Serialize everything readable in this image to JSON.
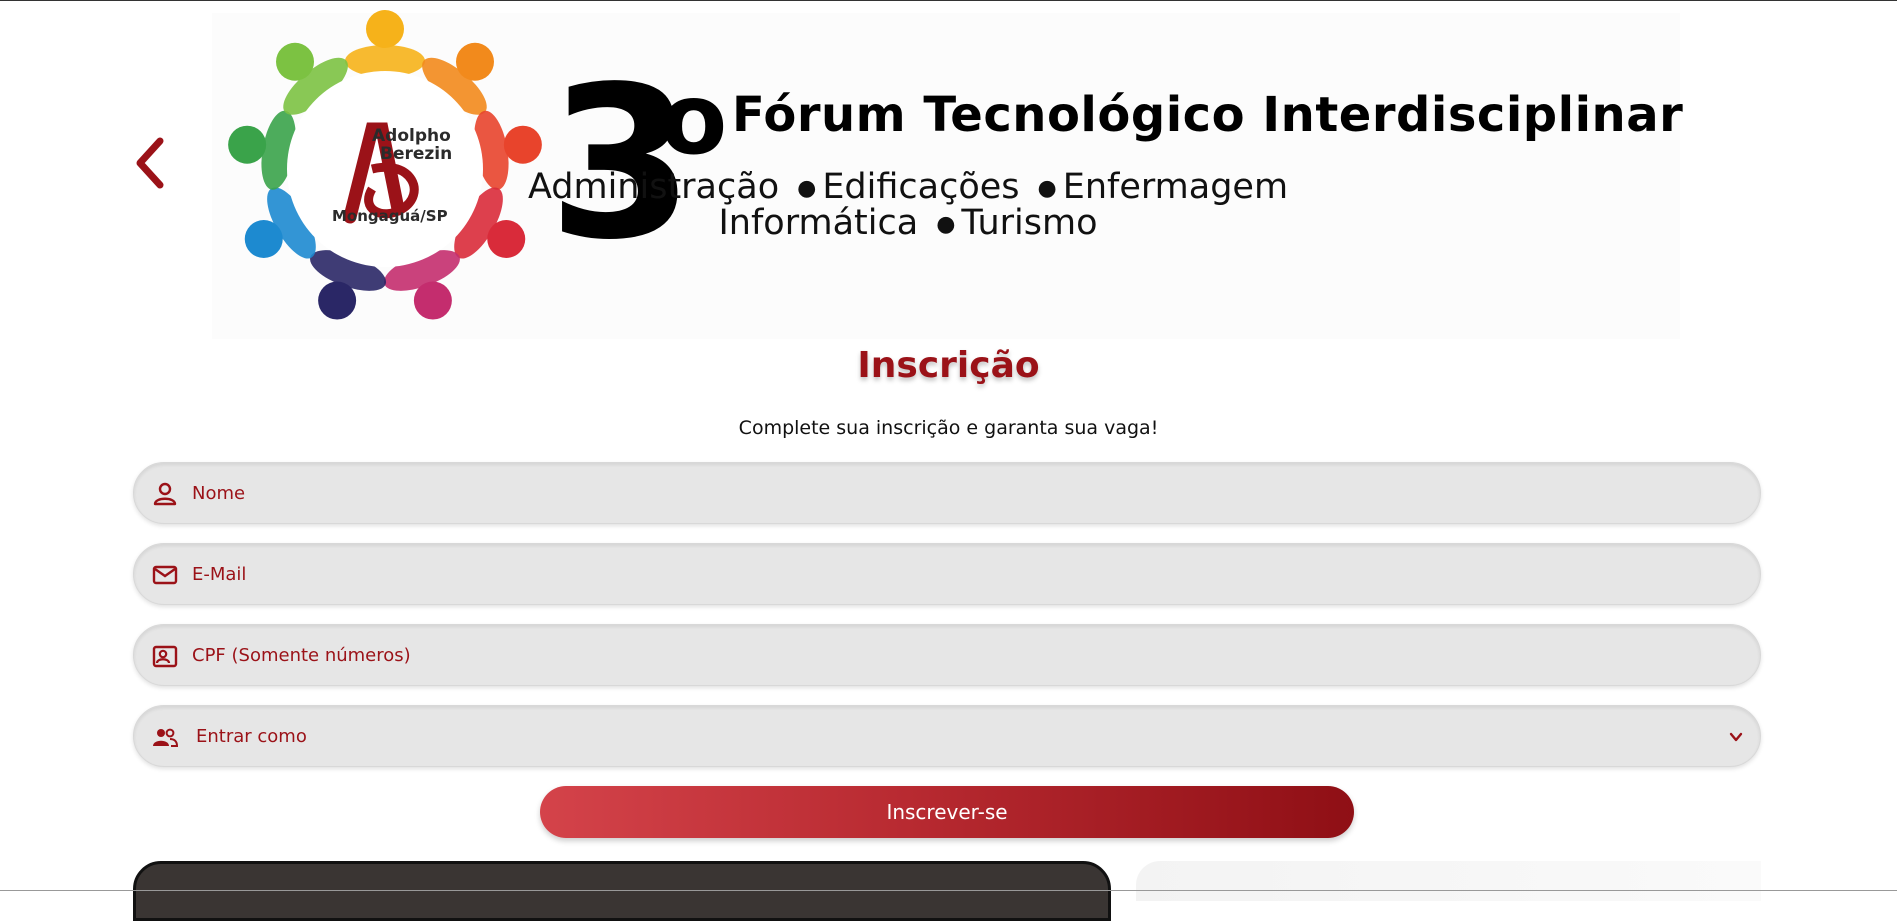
{
  "banner": {
    "logo": {
      "text_line1": "Adolpho",
      "text_line2": "Berezin",
      "city": "Mongaguá/SP",
      "colors": [
        "#f6b21a",
        "#f28a1c",
        "#e8442c",
        "#d92b3a",
        "#c42d6e",
        "#2a2766",
        "#1d8ad0",
        "#3aa34a",
        "#7cc242"
      ]
    },
    "edition_number": "3",
    "edition_ordinal": "o",
    "title": "Fórum Tecnológico Interdisciplinar",
    "courses_line1": [
      "Administração",
      "Edificações",
      "Enfermagem"
    ],
    "courses_line2": [
      "Informática",
      "Turismo"
    ]
  },
  "form": {
    "heading": "Inscrição",
    "subtitle": "Complete sua inscrição e garanta sua vaga!",
    "name_placeholder": "Nome",
    "email_placeholder": "E-Mail",
    "cpf_placeholder": "CPF (Somente números)",
    "role_selected": "Entrar como",
    "submit_label": "Inscrever-se"
  },
  "colors": {
    "brand": "#9b1218",
    "field_bg": "#e6e6e6",
    "button_start": "#d4434a",
    "button_end": "#8f0f15"
  },
  "icons": {
    "prev": "chevron-left-icon",
    "name": "person-icon",
    "email": "mail-icon",
    "cpf": "id-card-icon",
    "role": "group-icon",
    "select": "chevron-down-icon"
  }
}
